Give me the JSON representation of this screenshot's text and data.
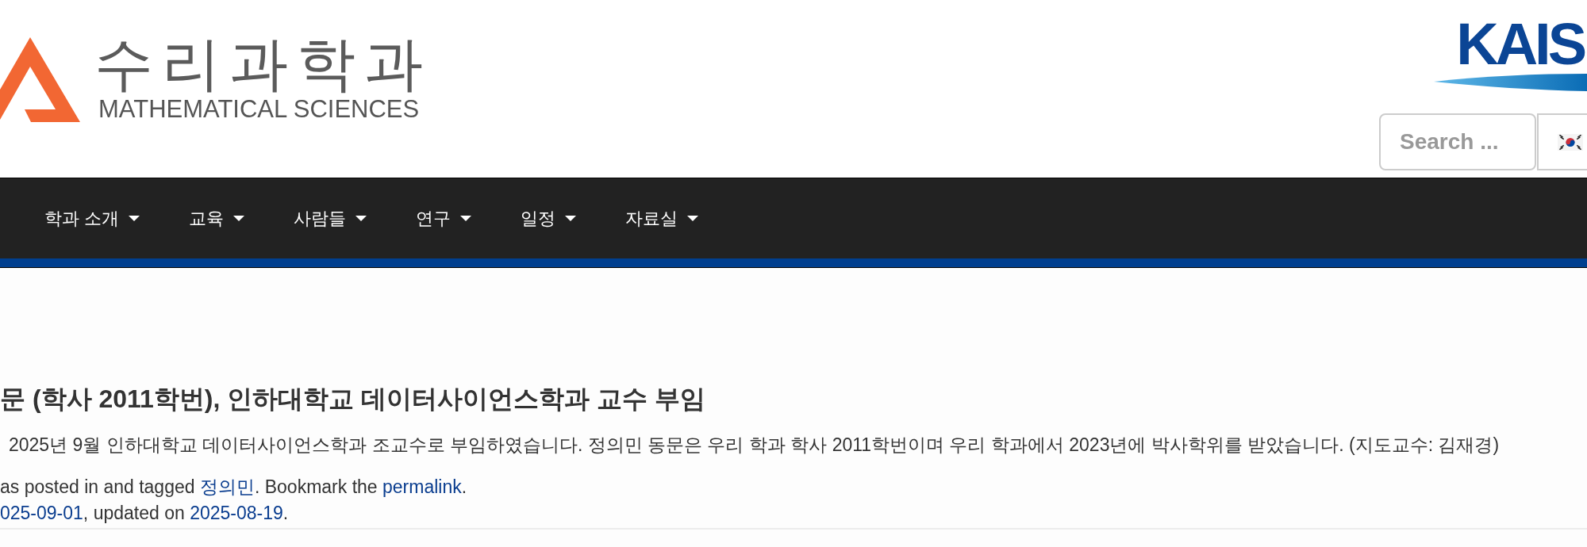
{
  "header": {
    "logo": {
      "title": "수리과학과",
      "subtitle": "MATHEMATICAL SCIENCES"
    },
    "university_logo": {
      "text": "KAIS"
    },
    "search": {
      "placeholder": "Search ..."
    }
  },
  "nav": {
    "items": [
      {
        "label": "학과 소개",
        "dropdown": true
      },
      {
        "label": "교육",
        "dropdown": true
      },
      {
        "label": "사람들",
        "dropdown": true
      },
      {
        "label": "연구",
        "dropdown": true
      },
      {
        "label": "일정",
        "dropdown": true
      },
      {
        "label": "자료실",
        "dropdown": true
      }
    ]
  },
  "post": {
    "title": "문 (학사 2011학번), 인하대학교 데이터사이언스학과 교수 부임",
    "body": "2025년 9월 인하대학교 데이터사이언스학과 조교수로 부임하였습니다. 정의민 동문은 우리 학과 학사 2011학번이며 우리 학과에서 2023년에 박사학위를 받았습니다. (지도교수: 김재경)",
    "meta": [
      {
        "segments": [
          {
            "kind": "text",
            "text": "as posted in and tagged "
          },
          {
            "kind": "tag",
            "text": "정의민"
          },
          {
            "kind": "text",
            "text": ". Bookmark the "
          },
          {
            "kind": "permalink",
            "text": "permalink"
          },
          {
            "kind": "text",
            "text": "."
          }
        ]
      },
      {
        "segments": [
          {
            "kind": "date",
            "text": "025-09-01"
          },
          {
            "kind": "text",
            "text": ", updated on "
          },
          {
            "kind": "date",
            "text": "2025-08-19"
          },
          {
            "kind": "text",
            "text": "."
          }
        ]
      }
    ]
  }
}
